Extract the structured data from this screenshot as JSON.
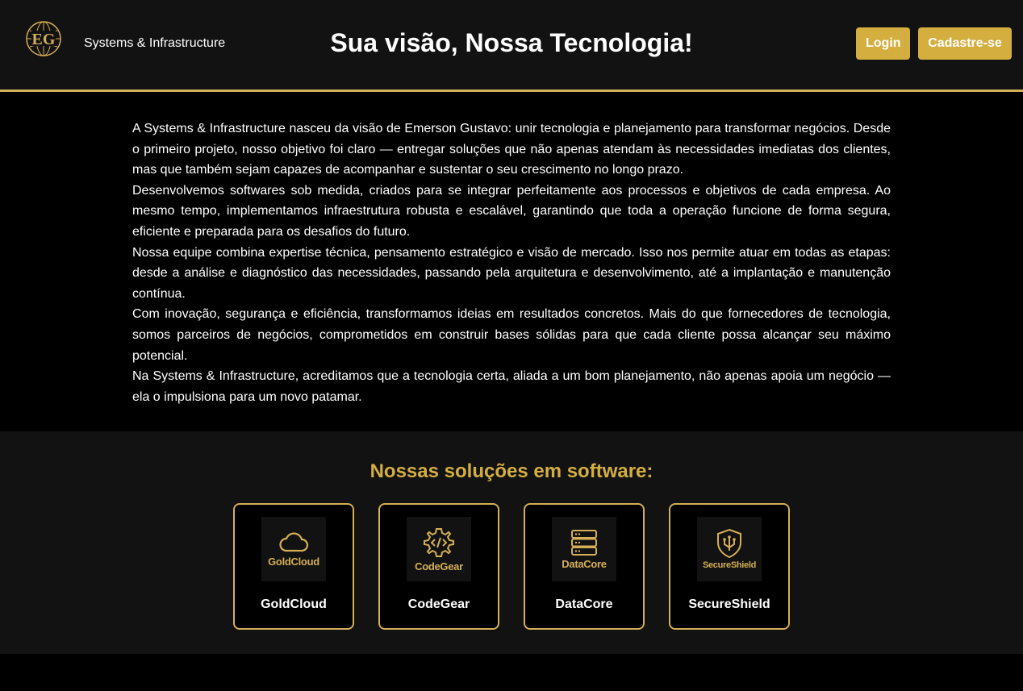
{
  "header": {
    "logo_text": "EG",
    "brand": "Systems & Infrastructure",
    "headline": "Sua visão, Nossa Tecnologia!",
    "login_label": "Login",
    "signup_label": "Cadastre-se"
  },
  "about": {
    "paragraphs": [
      "A Systems & Infrastructure nasceu da visão de Emerson Gustavo: unir tecnologia e planejamento para transformar negócios. Desde o primeiro projeto, nosso objetivo foi claro — entregar soluções que não apenas atendam às necessidades imediatas dos clientes, mas que também sejam capazes de acompanhar e sustentar o seu crescimento no longo prazo.",
      "Desenvolvemos softwares sob medida, criados para se integrar perfeitamente aos processos e objetivos de cada empresa. Ao mesmo tempo, implementamos infraestrutura robusta e escalável, garantindo que toda a operação funcione de forma segura, eficiente e preparada para os desafios do futuro.",
      "Nossa equipe combina expertise técnica, pensamento estratégico e visão de mercado. Isso nos permite atuar em todas as etapas: desde a análise e diagnóstico das necessidades, passando pela arquitetura e desenvolvimento, até a implantação e manutenção contínua.",
      "Com inovação, segurança e eficiência, transformamos ideias em resultados concretos. Mais do que fornecedores de tecnologia, somos parceiros de negócios, comprometidos em construir bases sólidas para que cada cliente possa alcançar seu máximo potencial.",
      "Na Systems & Infrastructure, acreditamos que a tecnologia certa, aliada a um bom planejamento, não apenas apoia um negócio — ela o impulsiona para um novo patamar."
    ]
  },
  "solutions": {
    "title": "Nossas soluções em software:",
    "items": [
      {
        "name": "GoldCloud",
        "logo_text": "GoldCloud",
        "icon": "cloud-icon"
      },
      {
        "name": "CodeGear",
        "logo_text": "CodeGear",
        "icon": "code-gear-icon"
      },
      {
        "name": "DataCore",
        "logo_text": "DataCore",
        "icon": "database-icon"
      },
      {
        "name": "SecureShield",
        "logo_text": "SecureShield",
        "icon": "shield-icon"
      }
    ]
  },
  "colors": {
    "gold": "#d4af40",
    "header_bg": "#121212",
    "page_bg": "#000000"
  }
}
